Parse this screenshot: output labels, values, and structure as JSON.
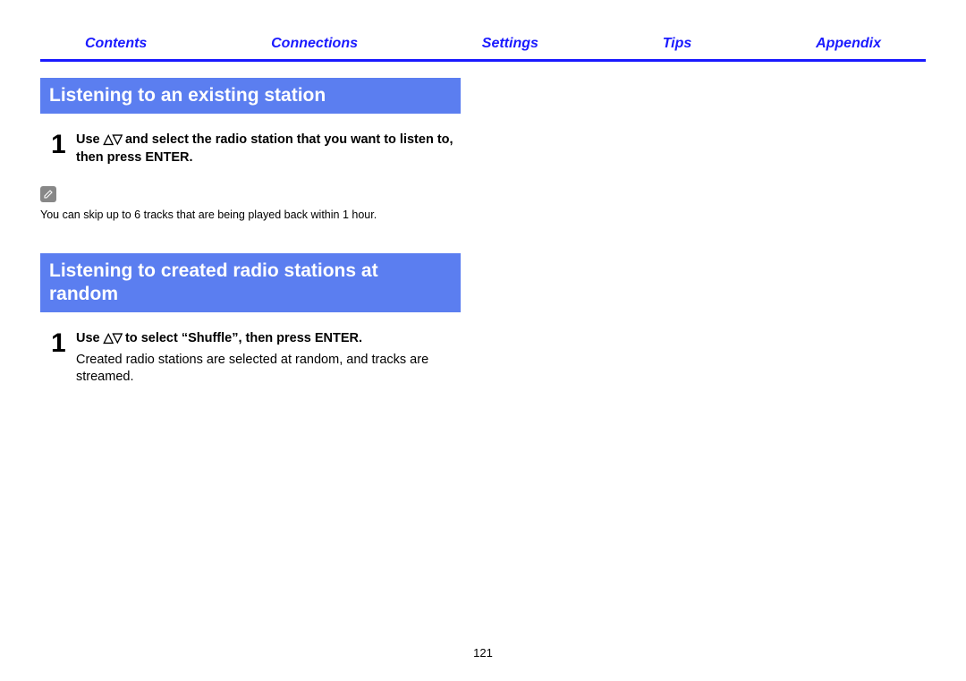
{
  "nav": {
    "contents": "Contents",
    "connections": "Connections",
    "settings": "Settings",
    "tips": "Tips",
    "appendix": "Appendix"
  },
  "section1": {
    "title": "Listening to an existing station",
    "step1_num": "1",
    "step1_pre": "Use ",
    "step1_arrows": "△▽",
    "step1_post": " and select the radio station that you want to listen to, then press ENTER."
  },
  "note1": {
    "text": "You can skip up to 6 tracks that are being played back within 1 hour."
  },
  "section2": {
    "title": "Listening to created radio stations at random",
    "step1_num": "1",
    "step1_pre": "Use ",
    "step1_arrows": "△▽",
    "step1_post": " to select “Shuffle”, then press ENTER.",
    "step1_desc": "Created radio stations are selected at random, and tracks are streamed."
  },
  "page_number": "121"
}
